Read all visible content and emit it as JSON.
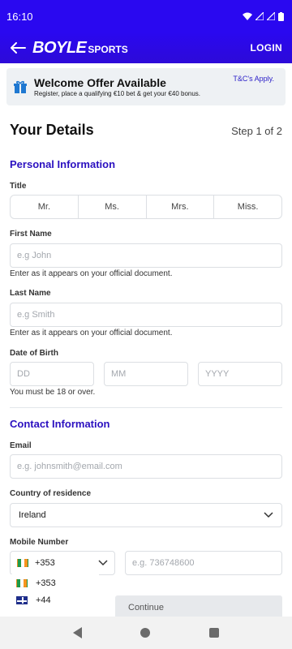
{
  "status_bar": {
    "time": "16:10"
  },
  "header": {
    "brand_main": "BOYLE",
    "brand_sub": "SPORTS",
    "login_label": "LOGIN"
  },
  "offer": {
    "title": "Welcome Offer Available",
    "subtitle": "Register, place a qualifying €10 bet & get your €40 bonus.",
    "tc_label": "T&C's Apply."
  },
  "page": {
    "title": "Your Details",
    "step": "Step 1 of 2"
  },
  "personal": {
    "heading": "Personal Information",
    "title_label": "Title",
    "title_options": [
      "Mr.",
      "Ms.",
      "Mrs.",
      "Miss."
    ],
    "first_name_label": "First Name",
    "first_name_placeholder": "e.g John",
    "first_name_hint": "Enter as it appears on your official document.",
    "last_name_label": "Last Name",
    "last_name_placeholder": "e.g Smith",
    "last_name_hint": "Enter as it appears on your official document.",
    "dob_label": "Date of Birth",
    "dob_day_placeholder": "DD",
    "dob_month_placeholder": "MM",
    "dob_year_placeholder": "YYYY",
    "dob_hint": "You must be 18 or over."
  },
  "contact": {
    "heading": "Contact Information",
    "email_label": "Email",
    "email_placeholder": "e.g. johnsmith@email.com",
    "country_label": "Country of residence",
    "country_value": "Ireland",
    "mobile_label": "Mobile Number",
    "code_value": "+353",
    "mobile_placeholder": "e.g. 736748600",
    "code_options": [
      {
        "code": "+353",
        "flag": "ie-flag-icon"
      },
      {
        "code": "+44",
        "flag": "gb-flag-icon"
      }
    ]
  },
  "actions": {
    "continue_label": "Continue"
  },
  "colors": {
    "brand": "#2a08f0",
    "accent_text": "#2b10c0"
  }
}
